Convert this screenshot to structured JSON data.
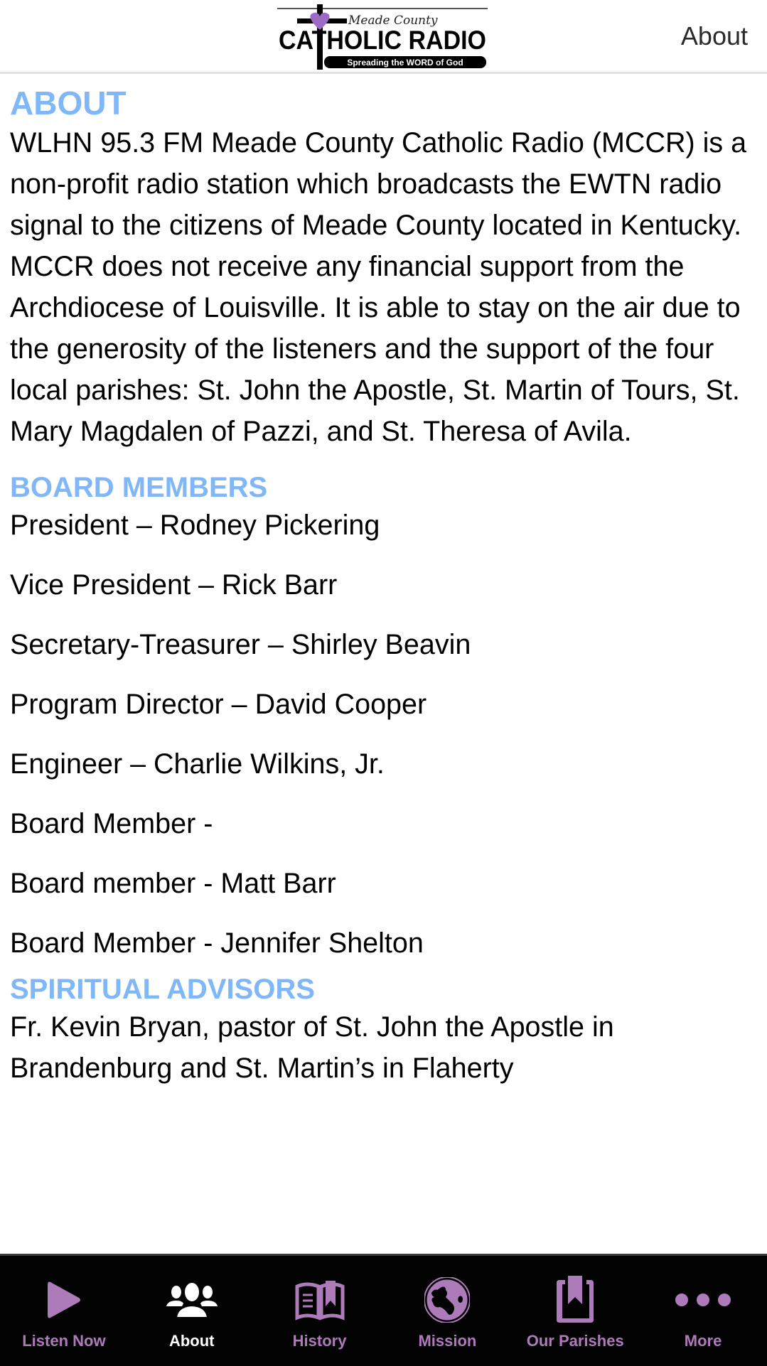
{
  "header": {
    "logo": {
      "top_script": "Meade County",
      "main_text": "CATHOLIC RADIO",
      "tagline": "Spreading the WORD of God"
    },
    "title": "About"
  },
  "about": {
    "heading": "ABOUT",
    "body": "WLHN 95.3 FM Meade County Catholic Radio (MCCR) is a non-profit radio station which broadcasts the EWTN radio signal to the citizens of Meade County located in Kentucky. MCCR does not receive any financial support from the Archdiocese of Louisville. It is able to stay on the air due to the generosity of the listeners and the support of the four local parishes: St. John the Apostle, St. Martin of Tours, St. Mary Magdalen of Pazzi, and St. Theresa of Avila."
  },
  "board": {
    "heading": "BOARD MEMBERS",
    "members": [
      "President – Rodney Pickering",
      "Vice President – Rick Barr",
      "Secretary-Treasurer – Shirley Beavin",
      "Program Director – David Cooper",
      "Engineer – Charlie Wilkins, Jr.",
      "Board Member -",
      "Board member - Matt Barr",
      "Board Member - Jennifer Shelton"
    ]
  },
  "advisors": {
    "heading": "SPIRITUAL ADVISORS",
    "body": "Fr. Kevin Bryan, pastor of St. John the Apostle in Brandenburg and St. Martin’s in Flaherty"
  },
  "tabbar": {
    "active_color": "#ffffff",
    "inactive_color": "#ad7bb9",
    "tabs": [
      {
        "label": "Listen Now",
        "icon": "play-icon",
        "active": false
      },
      {
        "label": "About",
        "icon": "people-icon",
        "active": true
      },
      {
        "label": "History",
        "icon": "open-book-icon",
        "active": false
      },
      {
        "label": "Mission",
        "icon": "globe-icon",
        "active": false
      },
      {
        "label": "Our Parishes",
        "icon": "bookmark-book-icon",
        "active": false
      },
      {
        "label": "More",
        "icon": "more-dots-icon",
        "active": false
      }
    ]
  },
  "colors": {
    "heading": "#7fb7f9",
    "logo_heart": "#9b6bc6",
    "tabbar_bg": "#030303"
  }
}
